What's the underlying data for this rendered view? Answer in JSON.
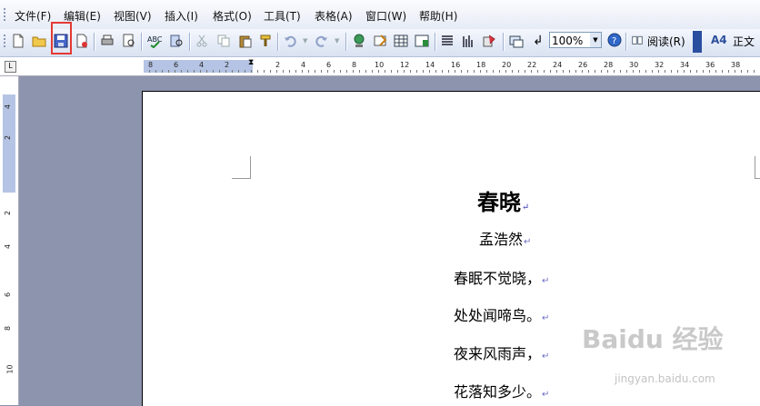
{
  "menu": [
    "文件(F)",
    "编辑(E)",
    "视图(V)",
    "插入(I)",
    "格式(O)",
    "工具(T)",
    "表格(A)",
    "窗口(W)",
    "帮助(H)"
  ],
  "toolbar": {
    "zoom": "100%",
    "read_label": "阅读(R)",
    "style_label": "正文",
    "style_icon_label": "A4"
  },
  "ruler": {
    "numbers": [
      "8",
      "6",
      "4",
      "2",
      "2",
      "4",
      "6",
      "8",
      "10",
      "12",
      "14",
      "16",
      "18",
      "20",
      "22",
      "24",
      "26",
      "28",
      "30",
      "32",
      "34",
      "36",
      "38"
    ],
    "vertical": [
      "4",
      "2",
      "2",
      "4",
      "6",
      "8",
      "10"
    ]
  },
  "document": {
    "title": "春晓",
    "author": "孟浩然",
    "lines": [
      "春眠不觉晓，",
      "处处闻啼鸟。",
      "夜来风雨声，",
      "花落知多少。"
    ]
  },
  "watermark": {
    "brand": "Baidu 经验",
    "url": "jingyan.baidu.com"
  }
}
